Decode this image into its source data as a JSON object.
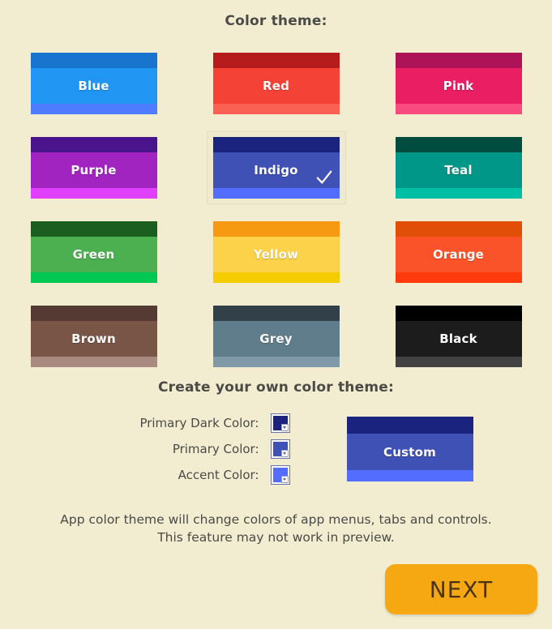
{
  "headings": {
    "color_theme": "Color theme:",
    "custom_theme": "Create your own color theme:"
  },
  "selected_theme": "Indigo",
  "check_icon": "check-icon",
  "themes": [
    [
      {
        "name": "Blue",
        "dark": "#1874cd",
        "main": "#2196f3",
        "accent": "#4d7cfe",
        "selected": false
      },
      {
        "name": "Red",
        "dark": "#b71c1c",
        "main": "#f44336",
        "accent": "#fa6152",
        "selected": false
      },
      {
        "name": "Pink",
        "dark": "#ad1457",
        "main": "#e91e63",
        "accent": "#fa4b80",
        "selected": false
      }
    ],
    [
      {
        "name": "Purple",
        "dark": "#4a148c",
        "main": "#a124c0",
        "accent": "#e040fb",
        "selected": false
      },
      {
        "name": "Indigo",
        "dark": "#1a237e",
        "main": "#3f51b5",
        "accent": "#536dfe",
        "selected": true
      },
      {
        "name": "Teal",
        "dark": "#004d40",
        "main": "#009688",
        "accent": "#00bfa5",
        "selected": false
      }
    ],
    [
      {
        "name": "Green",
        "dark": "#1b5e20",
        "main": "#4caf50",
        "accent": "#00c853",
        "selected": false
      },
      {
        "name": "Yellow",
        "dark": "#f59a11",
        "main": "#fbd24a",
        "accent": "#f5cc00",
        "selected": false
      },
      {
        "name": "Orange",
        "dark": "#e04e08",
        "main": "#fb5329",
        "accent": "#fd3b0d",
        "selected": false
      }
    ],
    [
      {
        "name": "Brown",
        "dark": "#543a32",
        "main": "#795548",
        "accent": "#a98a80",
        "selected": false
      },
      {
        "name": "Grey",
        "dark": "#324049",
        "main": "#607d8b",
        "accent": "#8099a8",
        "selected": false
      },
      {
        "name": "Black",
        "dark": "#000000",
        "main": "#1c1c1c",
        "accent": "#424242",
        "selected": false
      }
    ]
  ],
  "custom": {
    "fields": [
      {
        "label": "Primary Dark Color:",
        "color": "#1a237e",
        "name": "primary-dark-color"
      },
      {
        "label": "Primary Color:",
        "color": "#3f51b5",
        "name": "primary-color"
      },
      {
        "label": "Accent Color:",
        "color": "#536dfe",
        "name": "accent-color"
      }
    ],
    "preview": {
      "name": "Custom",
      "dark": "#1a237e",
      "main": "#3f51b5",
      "accent": "#536dfe"
    }
  },
  "footer": {
    "line1": "App color theme will change colors of app menus, tabs and controls.",
    "line2": "This feature may not work in preview."
  },
  "next_button": {
    "label": "NEXT",
    "color": "#f5a812"
  }
}
